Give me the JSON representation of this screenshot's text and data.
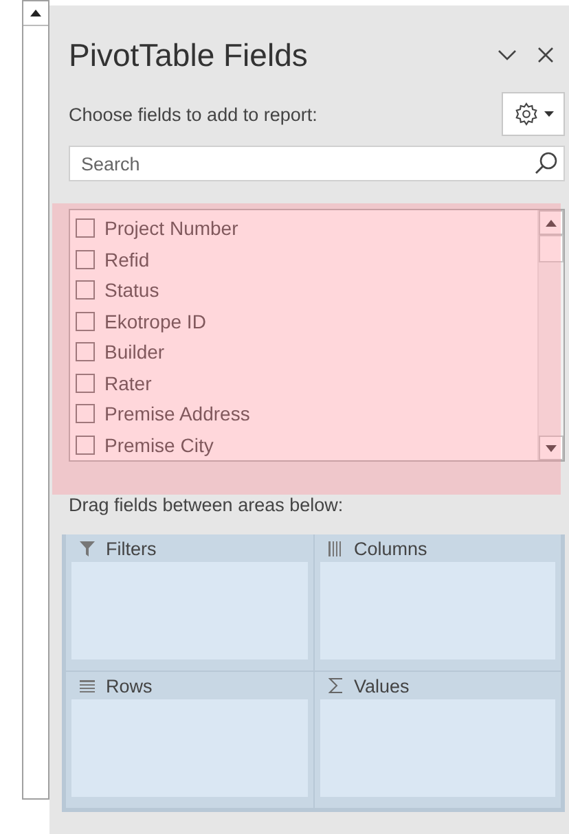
{
  "panel": {
    "title": "PivotTable Fields",
    "subtitle": "Choose fields to add to report:"
  },
  "search": {
    "placeholder": "Search"
  },
  "field_list": {
    "highlighted": true,
    "fields": [
      {
        "label": "Project Number",
        "checked": false
      },
      {
        "label": "Refid",
        "checked": false
      },
      {
        "label": "Status",
        "checked": false
      },
      {
        "label": "Ekotrope ID",
        "checked": false
      },
      {
        "label": "Builder",
        "checked": false
      },
      {
        "label": "Rater",
        "checked": false
      },
      {
        "label": "Premise Address",
        "checked": false
      },
      {
        "label": "Premise City",
        "checked": false
      }
    ]
  },
  "areas_hint": "Drag fields between areas below:",
  "areas": [
    {
      "kind": "filters",
      "label": "Filters"
    },
    {
      "kind": "columns",
      "label": "Columns"
    },
    {
      "kind": "rows",
      "label": "Rows"
    },
    {
      "kind": "values",
      "label": "Values"
    }
  ]
}
